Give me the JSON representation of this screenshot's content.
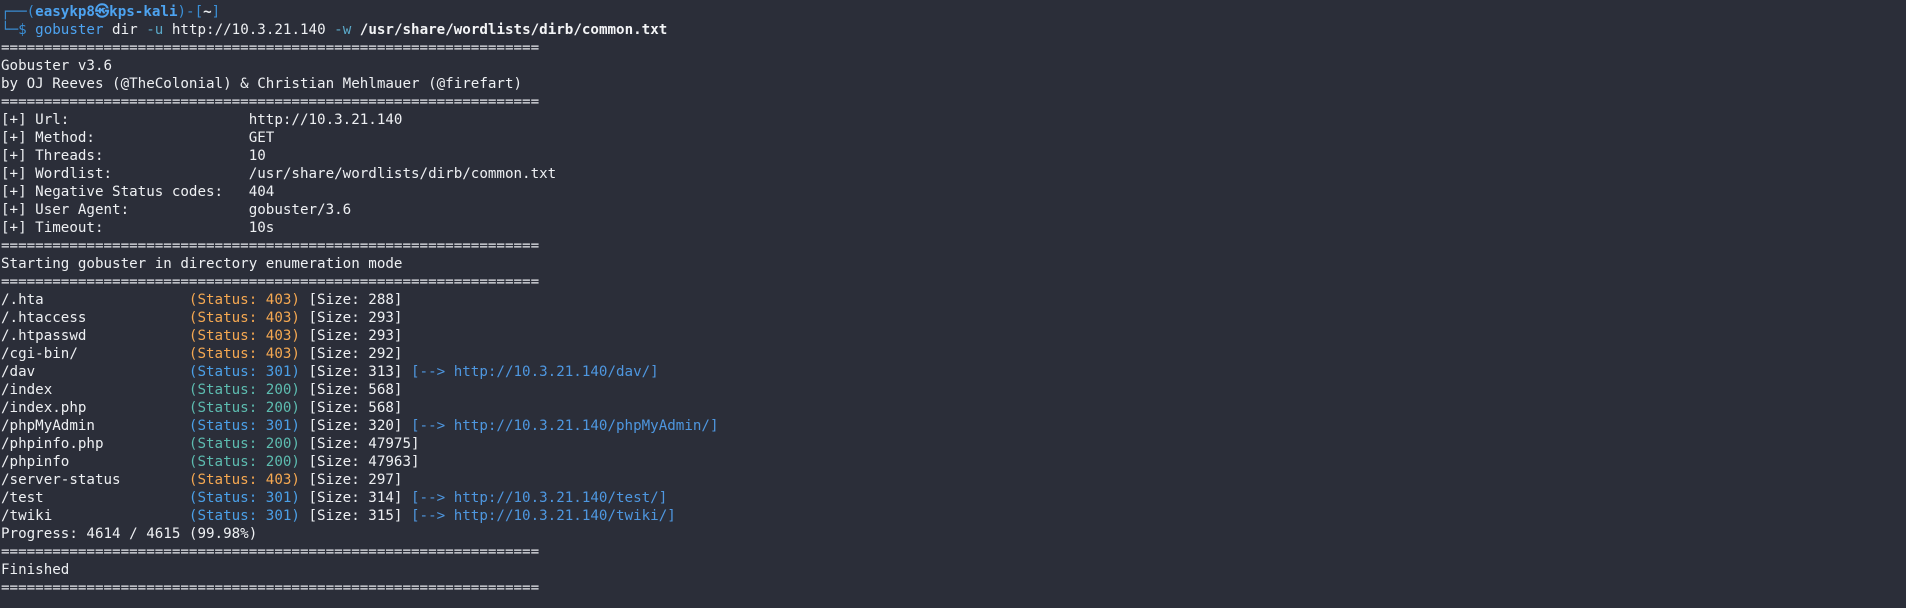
{
  "prompt": {
    "box_top": "┌──(",
    "user": "easykp8㉿kps-kali",
    "dir_open": ")-[",
    "dir": "~",
    "dir_close": "]",
    "box_bottom": "└─$ ",
    "command": "gobuster",
    "sub": " dir ",
    "flag_u": "-u",
    "url": " http://10.3.21.140 ",
    "flag_w": "-w",
    "wordlist": " /usr/share/wordlists/dirb/common.txt"
  },
  "separator": "===============================================================",
  "banner": {
    "version": "Gobuster v3.6",
    "author": "by OJ Reeves (@TheColonial) & Christian Mehlmauer (@firefart)"
  },
  "config": [
    {
      "key": "[+] Url:",
      "value": "http://10.3.21.140"
    },
    {
      "key": "[+] Method:",
      "value": "GET"
    },
    {
      "key": "[+] Threads:",
      "value": "10"
    },
    {
      "key": "[+] Wordlist:",
      "value": "/usr/share/wordlists/dirb/common.txt"
    },
    {
      "key": "[+] Negative Status codes:",
      "value": "404"
    },
    {
      "key": "[+] User Agent:",
      "value": "gobuster/3.6"
    },
    {
      "key": "[+] Timeout:",
      "value": "10s"
    }
  ],
  "start_message": "Starting gobuster in directory enumeration mode",
  "results": [
    {
      "path": "/.hta",
      "status": "(Status: 403)",
      "code": "403",
      "size": "[Size: 288]",
      "redirect": ""
    },
    {
      "path": "/.htaccess",
      "status": "(Status: 403)",
      "code": "403",
      "size": "[Size: 293]",
      "redirect": ""
    },
    {
      "path": "/.htpasswd",
      "status": "(Status: 403)",
      "code": "403",
      "size": "[Size: 293]",
      "redirect": ""
    },
    {
      "path": "/cgi-bin/",
      "status": "(Status: 403)",
      "code": "403",
      "size": "[Size: 292]",
      "redirect": ""
    },
    {
      "path": "/dav",
      "status": "(Status: 301)",
      "code": "301",
      "size": "[Size: 313]",
      "redirect": "[--> http://10.3.21.140/dav/]"
    },
    {
      "path": "/index",
      "status": "(Status: 200)",
      "code": "200",
      "size": "[Size: 568]",
      "redirect": ""
    },
    {
      "path": "/index.php",
      "status": "(Status: 200)",
      "code": "200",
      "size": "[Size: 568]",
      "redirect": ""
    },
    {
      "path": "/phpMyAdmin",
      "status": "(Status: 301)",
      "code": "301",
      "size": "[Size: 320]",
      "redirect": "[--> http://10.3.21.140/phpMyAdmin/]"
    },
    {
      "path": "/phpinfo.php",
      "status": "(Status: 200)",
      "code": "200",
      "size": "[Size: 47975]",
      "redirect": ""
    },
    {
      "path": "/phpinfo",
      "status": "(Status: 200)",
      "code": "200",
      "size": "[Size: 47963]",
      "redirect": ""
    },
    {
      "path": "/server-status",
      "status": "(Status: 403)",
      "code": "403",
      "size": "[Size: 297]",
      "redirect": ""
    },
    {
      "path": "/test",
      "status": "(Status: 301)",
      "code": "301",
      "size": "[Size: 314]",
      "redirect": "[--> http://10.3.21.140/test/]"
    },
    {
      "path": "/twiki",
      "status": "(Status: 301)",
      "code": "301",
      "size": "[Size: 315]",
      "redirect": "[--> http://10.3.21.140/twiki/]"
    }
  ],
  "progress": "Progress: 4614 / 4615 (99.98%)",
  "finished": "Finished",
  "colors": {
    "background": "#2b2e39",
    "status_403": "#f5a851",
    "status_301": "#4ba0e8",
    "status_200": "#5dbcb0"
  }
}
